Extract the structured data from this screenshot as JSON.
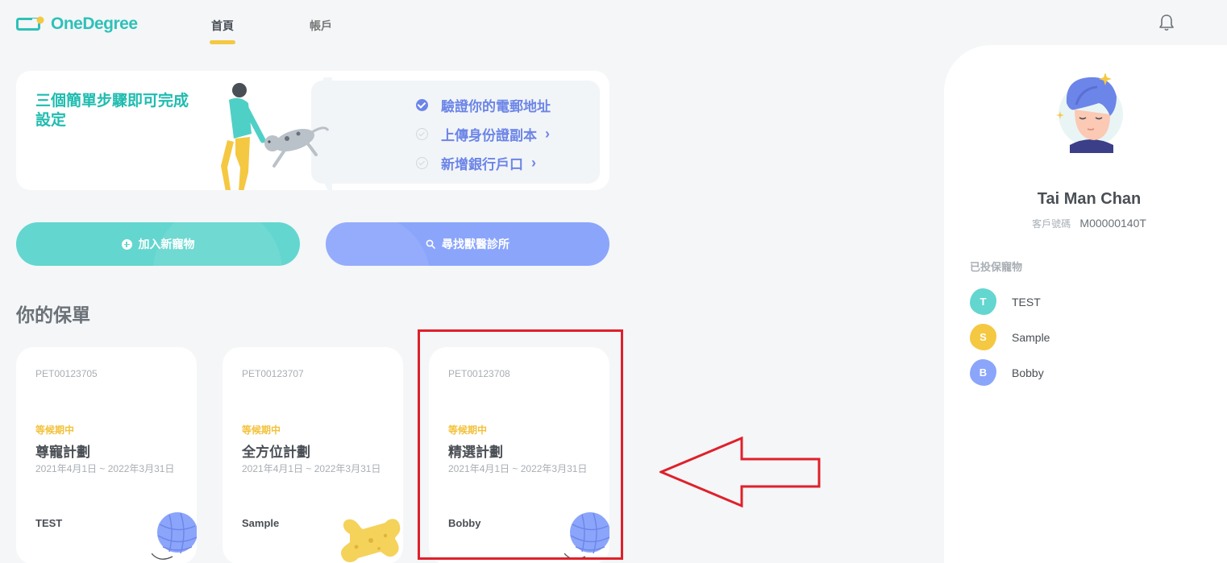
{
  "header": {
    "brand": "OneDegree",
    "tabs": [
      {
        "label": "首頁",
        "active": true
      },
      {
        "label": "帳戶",
        "active": false
      }
    ],
    "notification_icon": "bell-icon"
  },
  "setup": {
    "title": "三個簡單步驟即可完成設定",
    "steps": [
      {
        "label": "驗證你的電郵地址",
        "done": true
      },
      {
        "label": "上傳身份證副本",
        "done": false
      },
      {
        "label": "新增銀行戶口",
        "done": false
      }
    ]
  },
  "actions": {
    "add_pet": "加入新寵物",
    "find_clinic": "尋找獸醫診所"
  },
  "policies": {
    "title": "你的保單",
    "items": [
      {
        "id": "PET00123705",
        "status": "等候期中",
        "plan": "尊寵計劃",
        "period": "2021年4月1日 ~ 2022年3月31日",
        "pet": "TEST",
        "illustration": "yarn-ball-icon"
      },
      {
        "id": "PET00123707",
        "status": "等候期中",
        "plan": "全方位計劃",
        "period": "2021年4月1日 ~ 2022年3月31日",
        "pet": "Sample",
        "illustration": "bone-icon"
      },
      {
        "id": "PET00123708",
        "status": "等候期中",
        "plan": "精選計劃",
        "period": "2021年4月1日 ~ 2022年3月31日",
        "pet": "Bobby",
        "illustration": "yarn-ball-icon"
      }
    ]
  },
  "profile": {
    "name": "Tai Man Chan",
    "customer_no_label": "客戶號碼",
    "customer_no": "M00000140T",
    "insured_title": "已投保寵物",
    "pets": [
      {
        "initial": "T",
        "name": "TEST",
        "color": "#63d6cf"
      },
      {
        "initial": "S",
        "name": "Sample",
        "color": "#f5c842"
      },
      {
        "initial": "B",
        "name": "Bobby",
        "color": "#8ba5fb"
      }
    ]
  },
  "colors": {
    "brand": "#2ec1b8",
    "accent_yellow": "#f5c842",
    "accent_blue": "#6c85e8",
    "highlight_red": "#e0202a"
  }
}
